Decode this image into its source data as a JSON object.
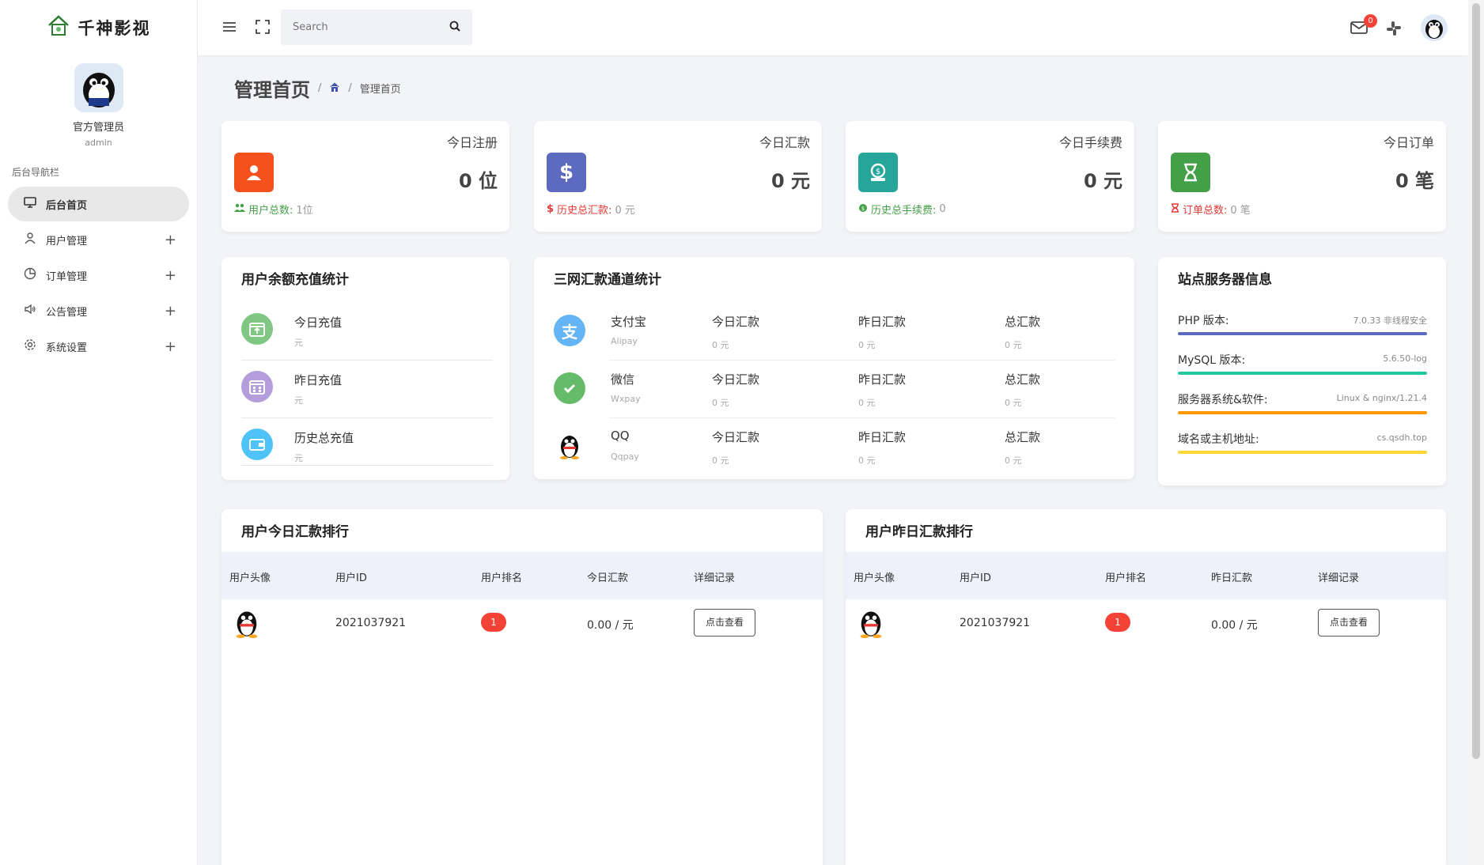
{
  "brand": {
    "title": "千神影视"
  },
  "profile": {
    "name": "官方管理员",
    "role": "admin"
  },
  "nav": {
    "title": "后台导航栏",
    "items": [
      {
        "label": "后台首页",
        "icon": "monitor-icon"
      },
      {
        "label": "用户管理",
        "icon": "user-icon"
      },
      {
        "label": "订单管理",
        "icon": "pie-chart-icon"
      },
      {
        "label": "公告管理",
        "icon": "speaker-icon"
      },
      {
        "label": "系统设置",
        "icon": "gear-icon"
      }
    ]
  },
  "topbar": {
    "search_placeholder": "Search",
    "mail_count": "0"
  },
  "page": {
    "title": "管理首页",
    "breadcrumb_current": "管理首页"
  },
  "stats": [
    {
      "label": "今日注册",
      "value": "0 位",
      "foot_label": "用户总数:",
      "foot_value": "1位",
      "color": "#f4511e",
      "foot_color": "#43a047"
    },
    {
      "label": "今日汇款",
      "value": "0 元",
      "foot_label": "历史总汇款:",
      "foot_value": "0 元",
      "color": "#5c6bc0",
      "foot_color": "#e53935"
    },
    {
      "label": "今日手续费",
      "value": "0 元",
      "foot_label": "历史总手续费:",
      "foot_value": "0",
      "color": "#26a69a",
      "foot_color": "#43a047"
    },
    {
      "label": "今日订单",
      "value": "0 笔",
      "foot_label": "订单总数:",
      "foot_value": "0 笔",
      "color": "#43a047",
      "foot_color": "#e53935"
    }
  ],
  "recharge": {
    "title": "用户余额充值统计",
    "rows": [
      {
        "label": "今日充值",
        "sub": "元"
      },
      {
        "label": "昨日充值",
        "sub": "元"
      },
      {
        "label": "历史总充值",
        "sub": "元"
      }
    ]
  },
  "channels": {
    "title": "三网汇款通道统计",
    "col_labels": [
      "今日汇款",
      "昨日汇款",
      "总汇款"
    ],
    "rows": [
      {
        "name": "支付宝",
        "sub": "Alipay",
        "values": [
          "0 元",
          "0 元",
          "0 元"
        ]
      },
      {
        "name": "微信",
        "sub": "Wxpay",
        "values": [
          "0 元",
          "0 元",
          "0 元"
        ]
      },
      {
        "name": "QQ",
        "sub": "Qqpay",
        "values": [
          "0 元",
          "0 元",
          "0 元"
        ]
      }
    ]
  },
  "server": {
    "title": "站点服务器信息",
    "rows": [
      {
        "key": "PHP 版本:",
        "value": "7.0.33 非线程安全",
        "color": "#5c6bc0"
      },
      {
        "key": "MySQL 版本:",
        "value": "5.6.50-log",
        "color": "#26c6a0"
      },
      {
        "key": "服务器系统&软件:",
        "value": "Linux & nginx/1.21.4",
        "color": "#ff9800"
      },
      {
        "key": "域名或主机地址:",
        "value": "cs.qsdh.top",
        "color": "#fdd835"
      }
    ]
  },
  "rank_today": {
    "title": "用户今日汇款排行",
    "headers": [
      "用户头像",
      "用户ID",
      "用户排名",
      "今日汇款",
      "详细记录"
    ],
    "row": {
      "uid": "2021037921",
      "rank": "1",
      "amount": "0.00 / 元",
      "button": "点击查看"
    }
  },
  "rank_yesterday": {
    "title": "用户昨日汇款排行",
    "headers": [
      "用户头像",
      "用户ID",
      "用户排名",
      "昨日汇款",
      "详细记录"
    ],
    "row": {
      "uid": "2021037921",
      "rank": "1",
      "amount": "0.00 / 元",
      "button": "点击查看"
    }
  }
}
